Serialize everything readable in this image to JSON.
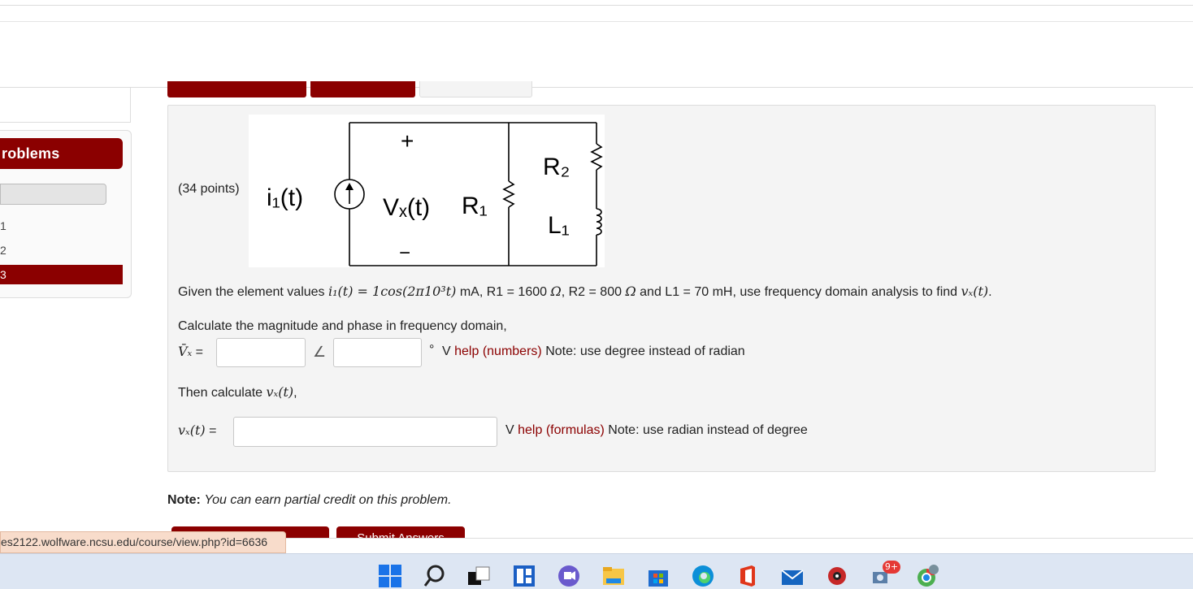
{
  "sidebar": {
    "header": "roblems",
    "items": [
      {
        "label": "1"
      },
      {
        "label": "2"
      },
      {
        "label": "3",
        "active": true
      }
    ]
  },
  "problem": {
    "points": "(34 points)",
    "circuit": {
      "plus": "+",
      "minus": "−",
      "source": "i₁(t)",
      "vx": "Vₓ(t)",
      "r1": "R₁",
      "r2": "R₂",
      "l1": "L₁"
    },
    "given_prefix": "Given the element values ",
    "given_i1": "i₁(t) = 1cos(2π10³t)",
    "given_r1": " mA, R1 = 1600 ",
    "ohm": "Ω",
    "given_r2": ", R2 = 800 ",
    "given_l1": " and L1 = 70 mH, use frequency domain analysis to find ",
    "given_vx": "vₓ(t)",
    "period": ".",
    "calc_prompt": "Calculate the magnitude and phase in frequency domain,",
    "vx_phasor_label": "V̄ₓ",
    "equals": " =",
    "angle_symbol": "∠",
    "degree_symbol": "°",
    "unit_v": "V",
    "help_numbers": "help (numbers)",
    "note_degree": "Note: use degree instead of radian",
    "then_prompt": "Then calculate ",
    "then_vx": "vₓ(t)",
    "comma": ",",
    "vxt_label": "vₓ(t)",
    "help_formulas": "help (formulas)",
    "note_radian": "Note: use radian instead of degree",
    "inputs": {
      "magnitude": "",
      "phase": "",
      "vxt": ""
    }
  },
  "note": {
    "bold": "Note:",
    "italic": "You can earn partial credit on this problem."
  },
  "bottom_button_2": "Submit Answers",
  "status_url": "es2122.wolfware.ncsu.edu/course/view.php?id=6636",
  "taskbar": {
    "icons": [
      "windows-start-icon",
      "search-icon",
      "task-view-icon",
      "widgets-icon",
      "teams-chat-icon",
      "file-explorer-icon",
      "microsoft-store-icon",
      "edge-icon",
      "office-icon",
      "mail-icon",
      "app-icon",
      "taskbar-app-icon",
      "chrome-icon"
    ],
    "badge": "9+"
  },
  "colors": {
    "accent": "#8b0000",
    "panel": "#f4f4f4",
    "taskbar": "#dde6f3"
  }
}
